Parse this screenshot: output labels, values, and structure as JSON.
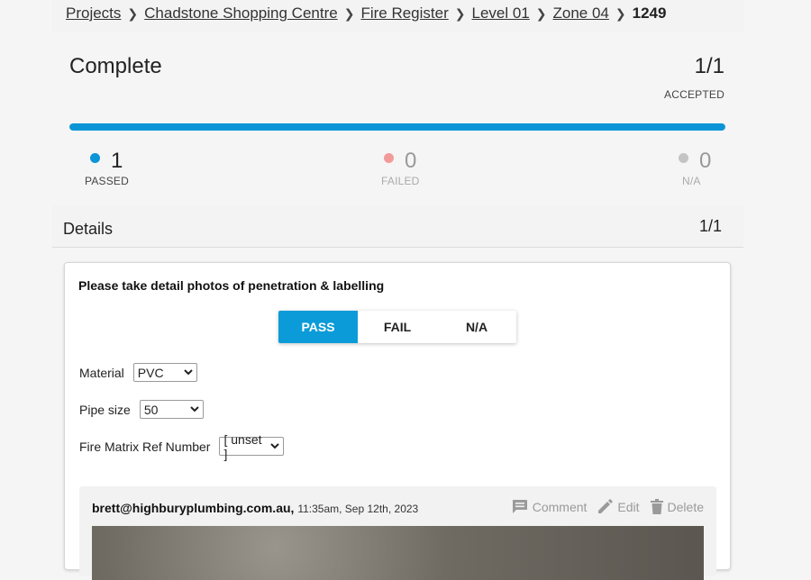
{
  "breadcrumb": {
    "items": [
      "Projects",
      "Chadstone Shopping Centre",
      "Fire Register",
      "Level 01",
      "Zone 04"
    ],
    "current": "1249"
  },
  "status": {
    "title": "Complete",
    "count": "1/1",
    "accepted_label": "ACCEPTED",
    "progress_fraction": 1.0
  },
  "stats": {
    "passed": {
      "value": "1",
      "label": "PASSED",
      "color": "#0b95d6"
    },
    "failed": {
      "value": "0",
      "label": "FAILED",
      "color": "#f29a9a"
    },
    "na": {
      "value": "0",
      "label": "N/A",
      "color": "#c4c4c4"
    }
  },
  "details": {
    "title": "Details",
    "count": "1/1"
  },
  "question": {
    "text": "Please take detail photos of penetration & labelling",
    "options": [
      "PASS",
      "FAIL",
      "N/A"
    ],
    "selected": "PASS"
  },
  "fields": {
    "material": {
      "label": "Material",
      "value": "PVC"
    },
    "pipe_size": {
      "label": "Pipe size",
      "value": "50"
    },
    "fire_matrix": {
      "label": "Fire Matrix Ref Number",
      "value": "[ unset ]"
    }
  },
  "comment": {
    "author": "brett@highburyplumbing.com.au",
    "time": "11:35am, Sep 12th, 2023",
    "actions": {
      "comment": "Comment",
      "edit": "Edit",
      "delete": "Delete"
    }
  },
  "colors": {
    "accent": "#0b9bd8"
  }
}
